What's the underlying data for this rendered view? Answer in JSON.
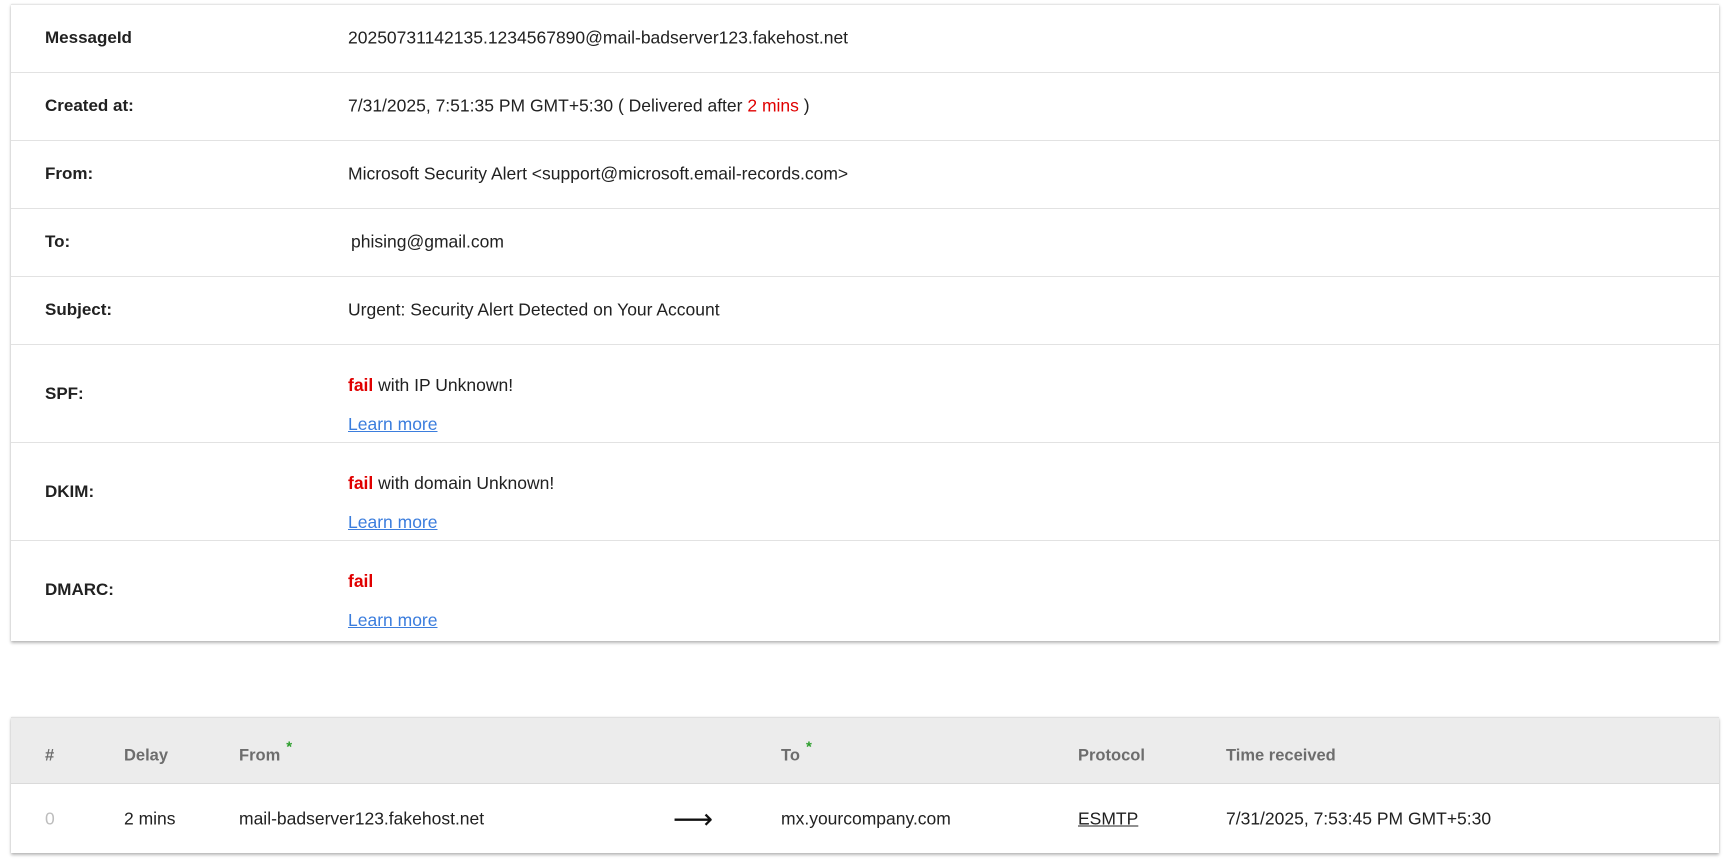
{
  "details": {
    "message_id": {
      "label": "MessageId",
      "value": "20250731142135.1234567890@mail-badserver123.fakehost.net"
    },
    "created_at": {
      "label": "Created at:",
      "value": "7/31/2025, 7:51:35 PM GMT+5:30",
      "delivered_prefix": "( Delivered after",
      "delay": "2 mins",
      "delivered_suffix": ")"
    },
    "from": {
      "label": "From:",
      "value": "Microsoft Security Alert <support@microsoft.email-records.com>"
    },
    "to": {
      "label": "To:",
      "value": "phising@gmail.com"
    },
    "subject": {
      "label": "Subject:",
      "value": "Urgent: Security Alert Detected on Your Account"
    },
    "spf": {
      "label": "SPF:",
      "status": "fail",
      "detail": "with IP Unknown!",
      "link": "Learn more"
    },
    "dkim": {
      "label": "DKIM:",
      "status": "fail",
      "detail": "with domain Unknown!",
      "link": "Learn more"
    },
    "dmarc": {
      "label": "DMARC:",
      "status": "fail",
      "link": "Learn more"
    }
  },
  "hops": {
    "headers": {
      "index": "#",
      "delay": "Delay",
      "from": "From",
      "to": "To",
      "protocol": "Protocol",
      "time_received": "Time received",
      "required_marker": "*"
    },
    "rows": [
      {
        "index": "0",
        "delay": "2 mins",
        "from": "mail-badserver123.fakehost.net",
        "arrow": "⟶",
        "to": "mx.yourcompany.com",
        "protocol": "ESMTP",
        "time_received": "7/31/2025, 7:53:45 PM GMT+5:30"
      }
    ]
  },
  "colors": {
    "fail": "#e00000",
    "link": "#3b7ddd",
    "star": "#2a9d2a",
    "header_bg": "#ececec"
  }
}
